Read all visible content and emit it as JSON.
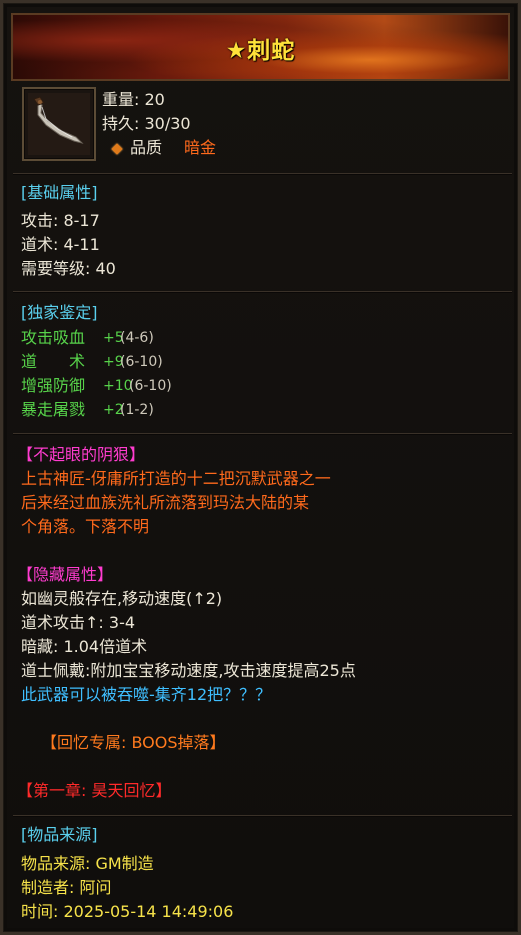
{
  "title": "★刺蛇",
  "icon": "serpent-dagger-icon",
  "basic": {
    "weight": "重量: 20",
    "durability": "持久: 30/30",
    "quality_label": "品质",
    "quality_value": "暗金"
  },
  "base_attr": {
    "header": "[基础属性]",
    "lines": [
      "攻击: 8-17",
      "道术: 4-11",
      "需要等级: 40"
    ]
  },
  "exclusive": {
    "header": "[独家鉴定]",
    "rows": [
      {
        "name": "攻击吸血",
        "bonus": "+5",
        "range": "(4-6)"
      },
      {
        "name": "道　　术",
        "bonus": "+9",
        "range": "(6-10)"
      },
      {
        "name": "增强防御",
        "bonus": "+10",
        "range": "(6-10)"
      },
      {
        "name": "暴走屠戮",
        "bonus": "+2",
        "range": "(1-2)"
      }
    ]
  },
  "lore": {
    "header": "【不起眼的阴狠】",
    "lines": [
      "上古神匠-伢庸所打造的十二把沉默武器之一",
      "后来经过血族洗礼所流落到玛法大陆的某",
      "个角落。下落不明"
    ]
  },
  "hidden": {
    "header": "【隐藏属性】",
    "lines": [
      "如幽灵般存在,移动速度(↑2)",
      "道术攻击↑: 3-4",
      "暗藏: 1.04倍道术",
      "道士佩戴:附加宝宝移动速度,攻击速度提高25点"
    ],
    "devour": "此武器可以被吞噬-集齐12把？？？"
  },
  "memory": "【回忆专属: BOOS掉落】",
  "chapter": "【第一章: 昊天回忆】",
  "source": {
    "header": "[物品来源]",
    "origin": "物品来源: GM制造",
    "maker": "制造者: 阿问",
    "time": "时间: 2025-05-14 14:49:06"
  },
  "colors": {
    "section": "#5ad0ee",
    "quality": "#ff6a1c",
    "green": "#57d24a",
    "lore": "#ff6a1c",
    "hidden_header": "#ff3ccf",
    "chapter": "#ff2a2a",
    "devour": "#3fbfff",
    "source_text": "#f6e24a",
    "title": "#ffe23a"
  }
}
